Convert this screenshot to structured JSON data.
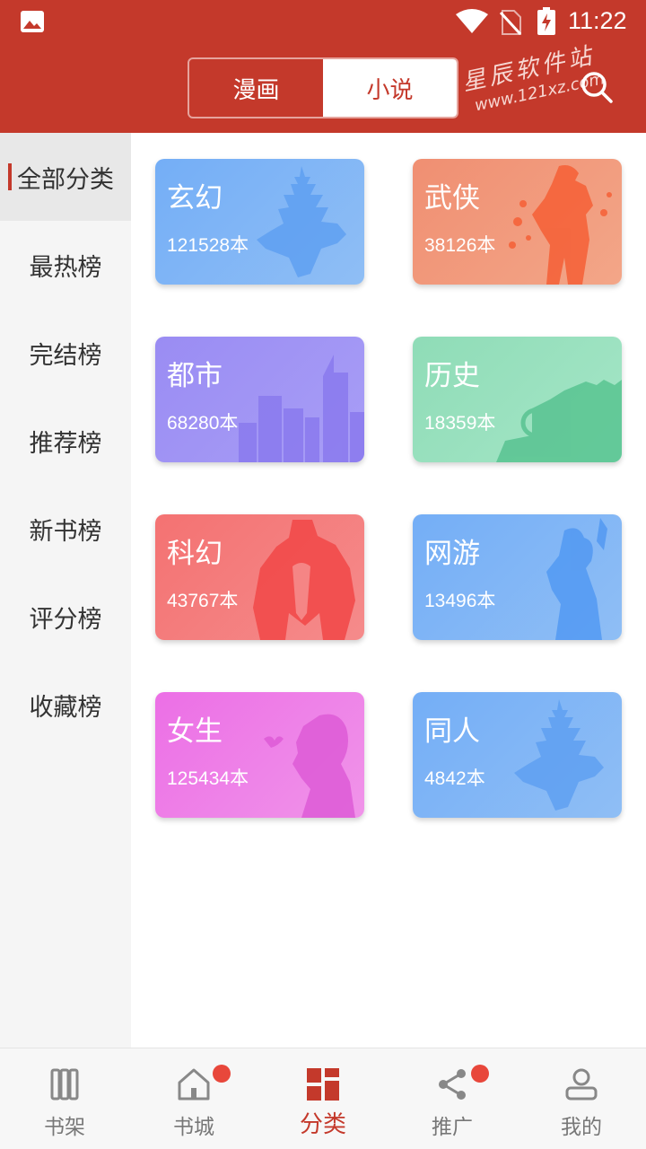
{
  "status_bar": {
    "time": "11:22",
    "icons": [
      "image-icon",
      "wifi-icon",
      "no-sim-icon",
      "battery-charging-icon"
    ]
  },
  "header": {
    "tabs": [
      {
        "label": "漫画",
        "active": false
      },
      {
        "label": "小说",
        "active": true
      }
    ],
    "watermark": {
      "line1": "星辰软件站",
      "line2": "www.121xz.com"
    },
    "search_icon": "search-icon"
  },
  "sidebar": {
    "items": [
      {
        "label": "全部分类",
        "active": true
      },
      {
        "label": "最热榜"
      },
      {
        "label": "完结榜"
      },
      {
        "label": "推荐榜"
      },
      {
        "label": "新书榜"
      },
      {
        "label": "评分榜"
      },
      {
        "label": "收藏榜"
      }
    ]
  },
  "categories": [
    {
      "title": "玄幻",
      "count": "121528本",
      "color": "#7fb4f5"
    },
    {
      "title": "武侠",
      "count": "38126本",
      "color": "#f2997a"
    },
    {
      "title": "都市",
      "count": "68280本",
      "color": "#a497f5"
    },
    {
      "title": "历史",
      "count": "18359本",
      "color": "#94e0bd"
    },
    {
      "title": "科幻",
      "count": "43767本",
      "color": "#f57f7f"
    },
    {
      "title": "网游",
      "count": "13496本",
      "color": "#7fb4f5"
    },
    {
      "title": "女生",
      "count": "125434本",
      "color": "#ef83e8"
    },
    {
      "title": "同人",
      "count": "4842本",
      "color": "#7fb4f5"
    }
  ],
  "bottom_nav": [
    {
      "label": "书架",
      "icon": "bookshelf-icon"
    },
    {
      "label": "书城",
      "icon": "home-icon",
      "badge": true
    },
    {
      "label": "分类",
      "icon": "category-grid-icon",
      "active": true
    },
    {
      "label": "推广",
      "icon": "share-icon",
      "badge": true
    },
    {
      "label": "我的",
      "icon": "profile-icon"
    }
  ],
  "colors": {
    "accent": "#c4392b",
    "badge": "#e8473b"
  }
}
